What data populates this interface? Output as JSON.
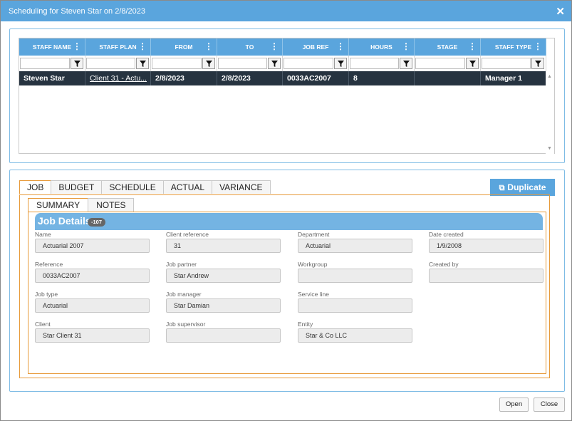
{
  "window": {
    "title": "Scheduling for Steven Star on 2/8/2023"
  },
  "grid": {
    "columns": [
      "STAFF NAME",
      "STAFF PLAN",
      "FROM",
      "TO",
      "JOB REF",
      "HOURS",
      "STAGE",
      "STAFF TYPE"
    ],
    "row": {
      "staff_name": "Steven Star",
      "staff_plan": "Client 31 - Actu...",
      "from": "2/8/2023",
      "to": "2/8/2023",
      "job_ref": "0033AC2007",
      "hours": "8",
      "stage": "",
      "staff_type": "Manager 1"
    }
  },
  "tabs": [
    "JOB",
    "BUDGET",
    "SCHEDULE",
    "ACTUAL",
    "VARIANCE"
  ],
  "active_tab": "JOB",
  "duplicate_label": "Duplicate",
  "subtabs": [
    "SUMMARY",
    "NOTES"
  ],
  "section": {
    "title": "Job Details",
    "badge": "-107"
  },
  "fields": {
    "name": {
      "label": "Name",
      "value": "Actuarial 2007"
    },
    "client_reference": {
      "label": "Client reference",
      "value": "31"
    },
    "department": {
      "label": "Department",
      "value": "Actuarial"
    },
    "date_created": {
      "label": "Date created",
      "value": "1/9/2008"
    },
    "reference": {
      "label": "Reference",
      "value": "0033AC2007"
    },
    "job_partner": {
      "label": "Job partner",
      "value": "Star Andrew"
    },
    "workgroup": {
      "label": "Workgroup",
      "value": ""
    },
    "created_by": {
      "label": "Created by",
      "value": ""
    },
    "job_type": {
      "label": "Job type",
      "value": "Actuarial"
    },
    "job_manager": {
      "label": "Job manager",
      "value": "Star Damian"
    },
    "service_line": {
      "label": "Service line",
      "value": ""
    },
    "client": {
      "label": "Client",
      "value": "Star Client 31"
    },
    "job_supervisor": {
      "label": "Job supervisor",
      "value": ""
    },
    "entity": {
      "label": "Entity",
      "value": "Star & Co LLC"
    }
  },
  "footer": {
    "open_label": "Open",
    "close_label": "Close"
  },
  "colors": {
    "header_blue": "#5aa5dd",
    "row_dark": "#263340",
    "accent_orange": "#e79a3a"
  }
}
